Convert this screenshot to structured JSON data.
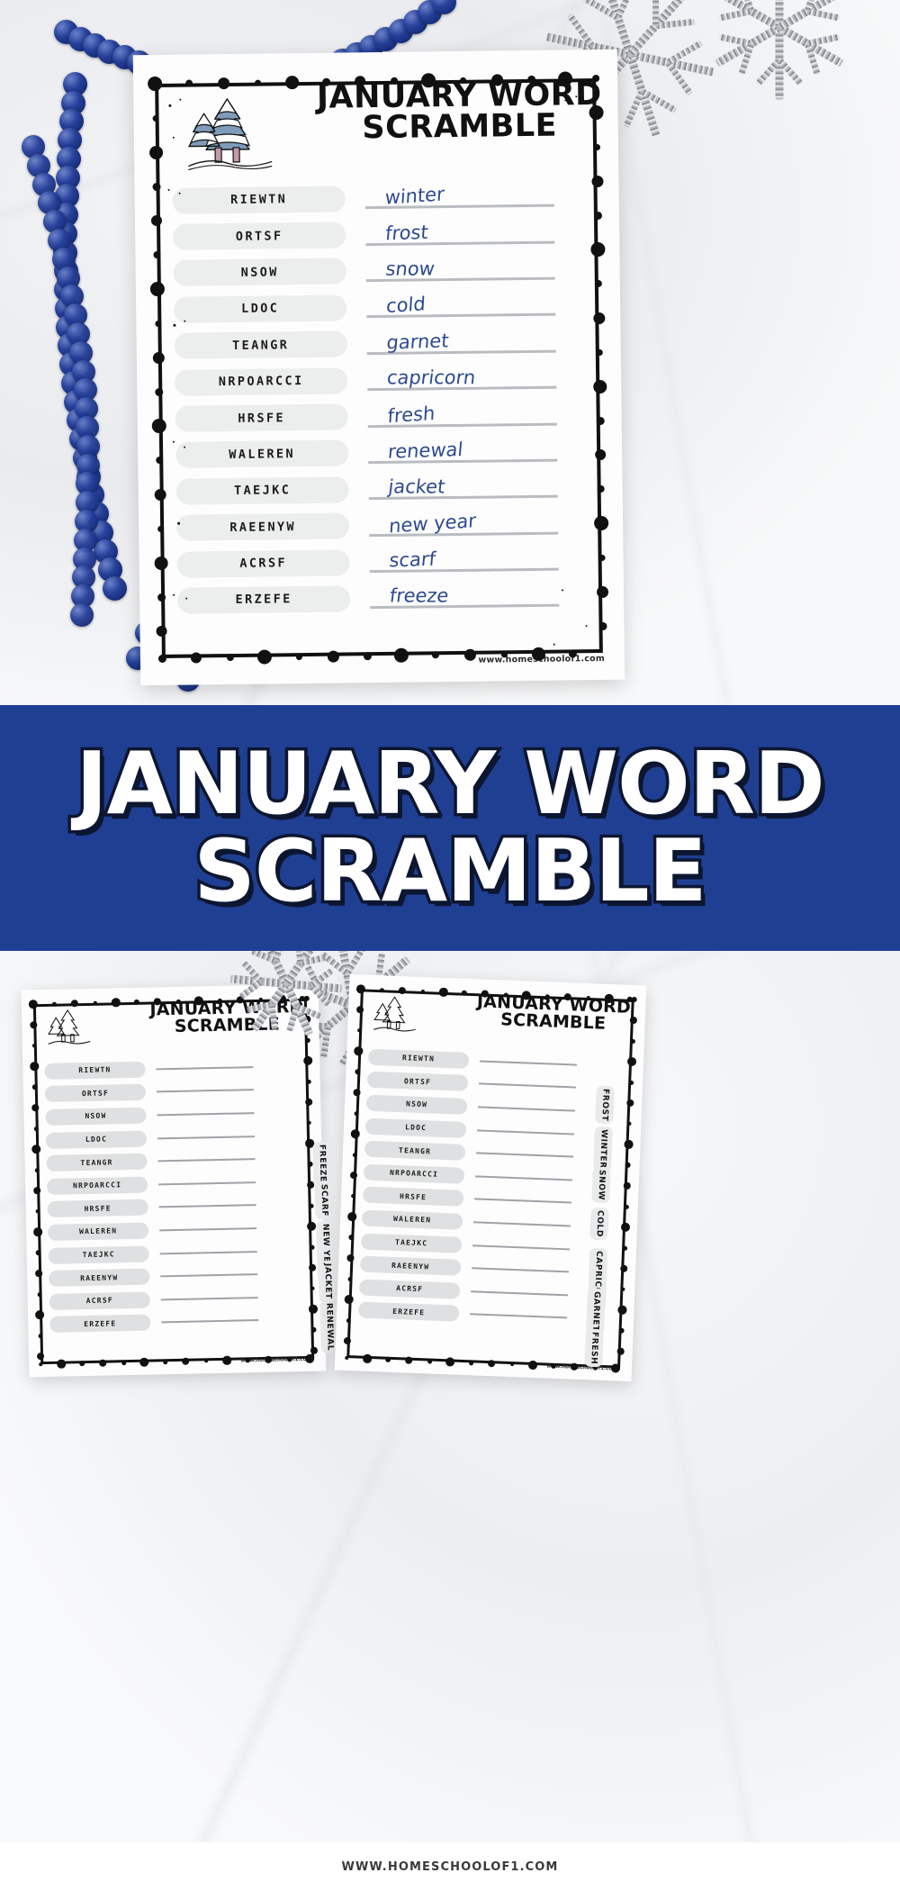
{
  "banner": {
    "line1": "JANUARY WORD",
    "line2": "SCRAMBLE",
    "background_color": "#1f3f92",
    "text_color": "#ffffff"
  },
  "worksheet": {
    "title_line1": "JANUARY WORD",
    "title_line2": "SCRAMBLE",
    "watermark": "www.homeschoolof1.com",
    "icon": "snowy-pine-trees",
    "scrambled_words": [
      "RIEWTN",
      "ORTSF",
      "NSOW",
      "LDOC",
      "TEANGR",
      "NRPOARCCI",
      "HRSFE",
      "WALEREN",
      "TAEJKC",
      "RAEENYW",
      "ACRSF",
      "ERZEFE"
    ],
    "handwritten_answers": [
      "winter",
      "frost",
      "snow",
      "cold",
      "garnet",
      "capricorn",
      "fresh",
      "renewal",
      "jacket",
      "new year",
      "scarf",
      "freeze"
    ]
  },
  "bottom_photo": {
    "left_sheet": {
      "title_line1": "JANUARY WORD",
      "title_line2": "SCRAMBLE",
      "watermark": "www.homeschoolof1.com",
      "scrambled_words": [
        "RIEWTN",
        "ORTSF",
        "NSOW",
        "LDOC",
        "TEANGR",
        "NRPOARCCI",
        "HRSFE",
        "WALEREN",
        "TAEJKC",
        "RAEENYW",
        "ACRSF",
        "ERZEFE"
      ],
      "answer_tabs": [
        "FREEZE",
        "SCARF",
        "NEW YEAR",
        "JACKET",
        "RENEWAL"
      ]
    },
    "right_sheet": {
      "title_line1": "JANUARY WORD",
      "title_line2": "SCRAMBLE",
      "watermark": "www.homeschoolof1.com",
      "scrambled_words": [
        "RIEWTN",
        "ORTSF",
        "NSOW",
        "LDOC",
        "TEANGR",
        "NRPOARCCI",
        "HRSFE",
        "WALEREN",
        "TAEJKC",
        "RAEENYW",
        "ACRSF",
        "ERZEFE"
      ],
      "answer_tabs": [
        "FROST",
        "WINTER",
        "SNOW",
        "COLD",
        "CAPRICORN",
        "GARNET",
        "FRESH"
      ]
    }
  },
  "footer": {
    "url": "WWW.HOMESCHOOLOF1.COM"
  }
}
